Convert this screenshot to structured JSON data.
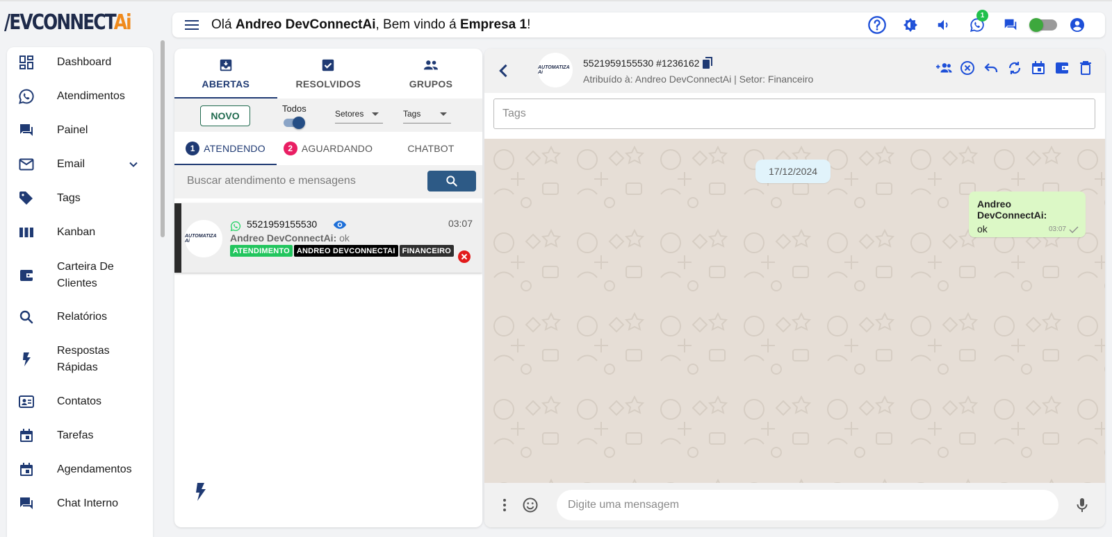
{
  "logo": {
    "main": "/EVCONNECT",
    "accent": "Ai"
  },
  "topbar": {
    "greeting_prefix": "Olá ",
    "user": "Andreo DevConnectAi",
    "greeting_middle": ", Bem vindo á ",
    "company": "Empresa 1",
    "greeting_suffix": "!",
    "notification_count": "1",
    "icons": [
      "help-icon",
      "theme-icon",
      "volume-icon",
      "whatsapp-icon",
      "chat-icon",
      "status-toggle",
      "account-icon"
    ]
  },
  "sidebar": {
    "items": [
      {
        "label": "Dashboard",
        "icon": "dashboard-icon"
      },
      {
        "label": "Atendimentos",
        "icon": "whatsapp-icon"
      },
      {
        "label": "Painel",
        "icon": "forum-icon"
      },
      {
        "label": "Email",
        "icon": "email-icon"
      },
      {
        "label": "Tags",
        "icon": "tag-icon"
      },
      {
        "label": "Kanban",
        "icon": "kanban-icon"
      },
      {
        "label": "Carteira De Clientes",
        "icon": "wallet-icon"
      },
      {
        "label": "Relatórios",
        "icon": "search-icon"
      },
      {
        "label": "Respostas Rápidas",
        "icon": "flash-icon"
      },
      {
        "label": "Contatos",
        "icon": "contacts-icon"
      },
      {
        "label": "Tarefas",
        "icon": "calendar-icon"
      },
      {
        "label": "Agendamentos",
        "icon": "calendar-icon"
      },
      {
        "label": "Chat Interno",
        "icon": "forum-icon"
      }
    ]
  },
  "tickets": {
    "tabs": [
      {
        "label": "ABERTAS",
        "icon": "inbox-icon"
      },
      {
        "label": "RESOLVIDOS",
        "icon": "checkbox-icon"
      },
      {
        "label": "GRUPOS",
        "icon": "group-icon"
      }
    ],
    "novo_label": "NOVO",
    "todos_label": "Todos",
    "setores_label": "Setores",
    "tags_label": "Tags",
    "subtabs": [
      {
        "label": "ATENDENDO",
        "badge": "1"
      },
      {
        "label": "AGUARDANDO",
        "badge": "2"
      },
      {
        "label": "CHATBOT",
        "badge": ""
      }
    ],
    "search_placeholder": "Buscar atendimento e mensagens",
    "list": [
      {
        "avatar_text": "AUTOMATIZA Ai",
        "number": "5521959155530",
        "time": "03:07",
        "last_author": "Andreo DevConnectAi:",
        "last_message": " ok",
        "tags": [
          {
            "label": "ATENDIMENTO",
            "color": "#22c55e"
          },
          {
            "label": "ANDREO DEVCONNECTAI",
            "color": "#000000"
          },
          {
            "label": "FINANCEIRO",
            "color": "#2e2e2e"
          }
        ]
      }
    ]
  },
  "chat": {
    "contact": "5521959155530 #1236162",
    "assigned": "Atribuído à: Andreo DevConnectAi | Setor: Financeiro",
    "avatar_text": "AUTOMATIZA Ai",
    "tags_placeholder": "Tags",
    "date_chip": "17/12/2024",
    "messages": [
      {
        "author": "Andreo DevConnectAi:",
        "text": "ok",
        "time": "03:07"
      }
    ],
    "composer_placeholder": "Digite uma mensagem"
  },
  "colors": {
    "primary": "#1f3a73",
    "accent_blue": "#1d4fd8",
    "search_button": "#2d5a86",
    "whatsapp_green": "#25d366",
    "bubble_out": "#dcf8c6",
    "chat_bg": "#e6ded6",
    "badge_red": "#e91e63"
  }
}
